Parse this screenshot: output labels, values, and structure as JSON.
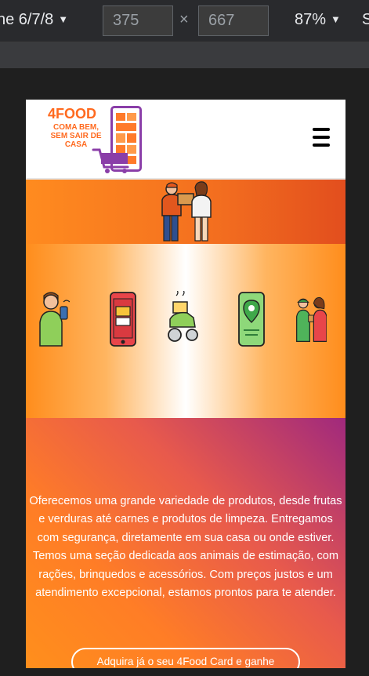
{
  "devtools": {
    "device": "ne 6/7/8",
    "width": "375",
    "height": "667",
    "times": "×",
    "zoom": "87%",
    "dropdown_arrow": "▼",
    "trailing": "S"
  },
  "site": {
    "logo": {
      "title": "4FOOD",
      "tagline_line1": "COMA BEM,",
      "tagline_line2": "SEM SAIR DE",
      "tagline_line3": "CASA"
    },
    "description": "Oferecemos uma grande variedade de produtos, desde frutas e verduras até carnes e produtos de limpeza. Entregamos com segurança, diretamente em sua casa ou onde estiver. Temos uma seção dedicada aos animais de estimação, com rações, brinquedos e acessórios. Com preços justos e um atendimento excepcional, estamos prontos para te atender.",
    "cta": "Adquira já o seu 4Food Card e ganhe",
    "icons": [
      "menu-icon",
      "delivery-handoff-icon",
      "customer-phone-icon",
      "store-app-icon",
      "delivery-scooter-icon",
      "map-location-icon",
      "order-received-icon"
    ],
    "colors": {
      "brand_orange": "#ff6a1f",
      "brand_purple": "#8a3ea8",
      "gradient_purple": "#a0297d"
    }
  }
}
